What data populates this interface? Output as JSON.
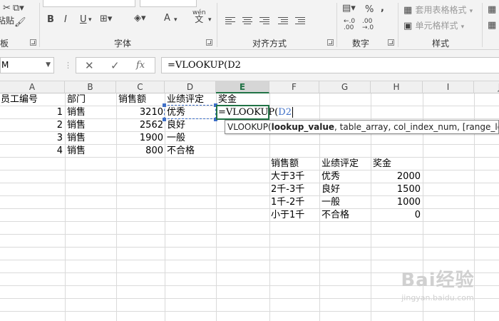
{
  "ribbon": {
    "clipboard_label": "粘贴",
    "clipboard_group": "剪贴板",
    "font_group": "字体",
    "bold": "B",
    "italic": "I",
    "underline": "U",
    "font_color_glyph": "A",
    "wen_glyph": "wén",
    "wen_char": "文",
    "align_group": "对齐方式",
    "number_group": "数字",
    "percent": "%",
    "comma": ",",
    "styles_group": "样式",
    "table_format": "套用表格格式",
    "cell_styles": "单元格样式"
  },
  "formula_bar": {
    "name_box": "M",
    "cancel": "✕",
    "enter": "✓",
    "fx": "fx",
    "formula": "=VLOOKUP(D2"
  },
  "columns": [
    "A",
    "B",
    "C",
    "D",
    "E",
    "F",
    "G",
    "H",
    "I",
    "J"
  ],
  "selected_column": "E",
  "table1": {
    "headers": {
      "a": "员工编号",
      "b": "部门",
      "c": "销售额",
      "d": "业绩评定",
      "e": "奖金"
    },
    "rows": [
      {
        "id": "1",
        "dept": "销售",
        "sales": "3210",
        "rating": "优秀"
      },
      {
        "id": "2",
        "dept": "销售",
        "sales": "2562",
        "rating": "良好"
      },
      {
        "id": "3",
        "dept": "销售",
        "sales": "1900",
        "rating": "一般"
      },
      {
        "id": "4",
        "dept": "销售",
        "sales": "800",
        "rating": "不合格"
      }
    ],
    "editing_cell": {
      "prefix": "=VLOOKUP(",
      "ref": "D2"
    }
  },
  "tooltip": {
    "fn": "VLOOKUP(",
    "arg1": "lookup_value",
    "rest": ", table_array, col_index_num, [range_lookup])"
  },
  "table2": {
    "headers": {
      "sales": "销售额",
      "rating": "业绩评定",
      "bonus": "奖金"
    },
    "rows": [
      {
        "sales": "大于3千",
        "rating": "优秀",
        "bonus": "2000"
      },
      {
        "sales": "2千-3千",
        "rating": "良好",
        "bonus": "1500"
      },
      {
        "sales": "1千-2千",
        "rating": "一般",
        "bonus": "1000"
      },
      {
        "sales": "小于1千",
        "rating": "不合格",
        "bonus": "0"
      }
    ]
  },
  "watermark": {
    "brand": "Bai经验",
    "url": "jingyan.baidu.com"
  },
  "colors": {
    "accent": "#217346",
    "copy_range": "#3e6fc7"
  }
}
